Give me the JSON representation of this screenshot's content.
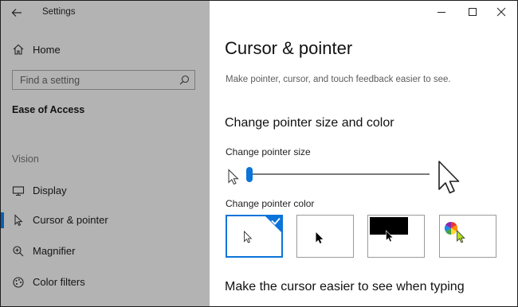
{
  "window": {
    "title": "Settings"
  },
  "sidebar": {
    "home_label": "Home",
    "search_placeholder": "Find a setting",
    "section_title": "Ease of Access",
    "group_title": "Vision",
    "items": [
      {
        "label": "Display",
        "icon": "monitor-icon",
        "active": false
      },
      {
        "label": "Cursor & pointer",
        "icon": "cursor-icon",
        "active": true
      },
      {
        "label": "Magnifier",
        "icon": "magnifier-icon",
        "active": false
      },
      {
        "label": "Color filters",
        "icon": "color-filters-icon",
        "active": false
      }
    ]
  },
  "main": {
    "title": "Cursor & pointer",
    "description": "Make pointer, cursor, and touch feedback easier to see.",
    "pointer_section": {
      "header": "Change pointer size and color",
      "size_label": "Change pointer size",
      "size_value": 1,
      "color_label": "Change pointer color",
      "color_options": [
        "white",
        "black",
        "inverted",
        "custom"
      ],
      "selected_color": "white"
    },
    "typing_header": "Make the cursor easier to see when typing"
  },
  "colors": {
    "sidebar_bg": "#b3b3b3",
    "accent": "#0a74da",
    "active_indicator": "#0a5fb4",
    "custom_cursor": "#b3e21d"
  }
}
